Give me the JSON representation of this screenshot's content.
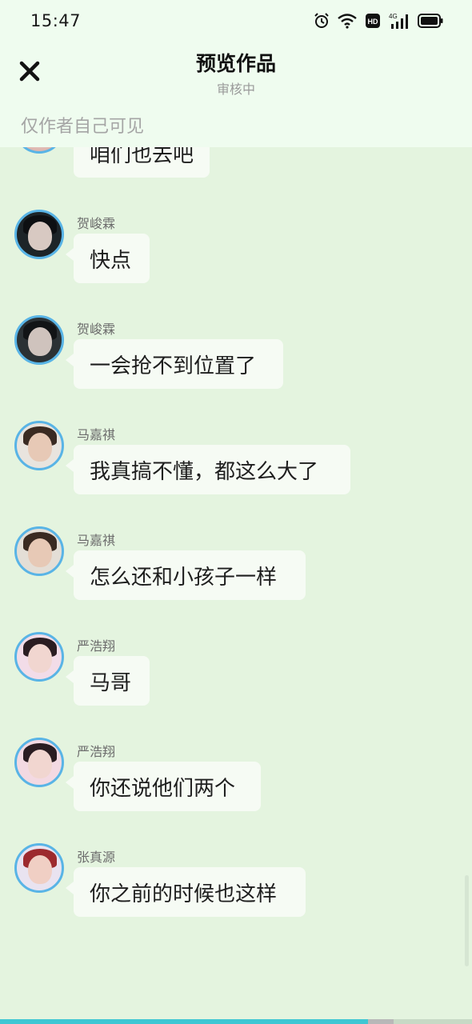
{
  "status_bar": {
    "time": "15:47",
    "icons": [
      "alarm-icon",
      "wifi-icon",
      "hd-icon",
      "signal-4g-icon",
      "battery-icon"
    ],
    "hd_label": "HD",
    "network_label": "4G"
  },
  "header": {
    "title": "预览作品",
    "subtitle": "审核中",
    "visibility_note": "仅作者自己可见",
    "close_icon": "close-icon"
  },
  "partial_message": {
    "text": "咱们也去吧"
  },
  "messages": [
    {
      "sender": "贺峻霖",
      "text": "快点"
    },
    {
      "sender": "贺峻霖",
      "text": "一会抢不到位置了"
    },
    {
      "sender": "马嘉祺",
      "text": "我真搞不懂，都这么大了"
    },
    {
      "sender": "马嘉祺",
      "text": "怎么还和小孩子一样"
    },
    {
      "sender": "严浩翔",
      "text": "马哥"
    },
    {
      "sender": "严浩翔",
      "text": "你还说他们两个"
    },
    {
      "sender": "张真源",
      "text": "你之前的时候也这样"
    }
  ],
  "colors": {
    "background": "#e4f4df",
    "header_background": "#effcef",
    "bubble": "#f6fbf4",
    "avatar_ring": "#59b4e6",
    "progress": "#3ec7d3"
  },
  "progress": {
    "fraction": 0.78
  }
}
